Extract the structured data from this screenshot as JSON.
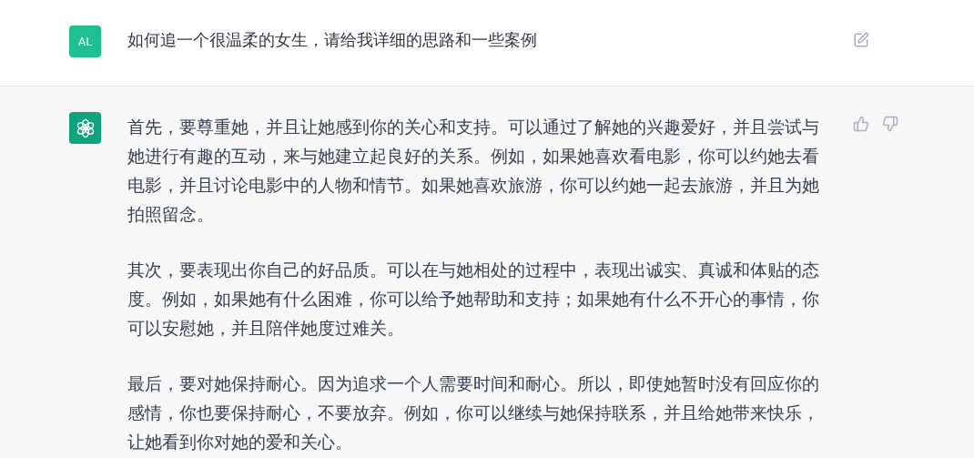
{
  "user_message": {
    "avatar": "AL",
    "text": "如何追一个很温柔的女生，请给我详细的思路和一些案例"
  },
  "assistant_message": {
    "paragraphs": [
      "首先，要尊重她，并且让她感到你的关心和支持。可以通过了解她的兴趣爱好，并且尝试与她进行有趣的互动，来与她建立起良好的关系。例如，如果她喜欢看电影，你可以约她去看电影，并且讨论电影中的人物和情节。如果她喜欢旅游，你可以约她一起去旅游，并且为她拍照留念。",
      "其次，要表现出你自己的好品质。可以在与她相处的过程中，表现出诚实、真诚和体贴的态度。例如，如果她有什么困难，你可以给予她帮助和支持；如果她有什么不开心的事情，你可以安慰她，并且陪伴她度过难关。",
      "最后，要对她保持耐心。因为追求一个人需要时间和耐心。所以，即使她暂时没有回应你的感情，你也要保持耐心，不要放弃。例如，你可以继续与她保持联系，并且给她带来快乐，让她看到你对她的爱和关心。"
    ]
  }
}
